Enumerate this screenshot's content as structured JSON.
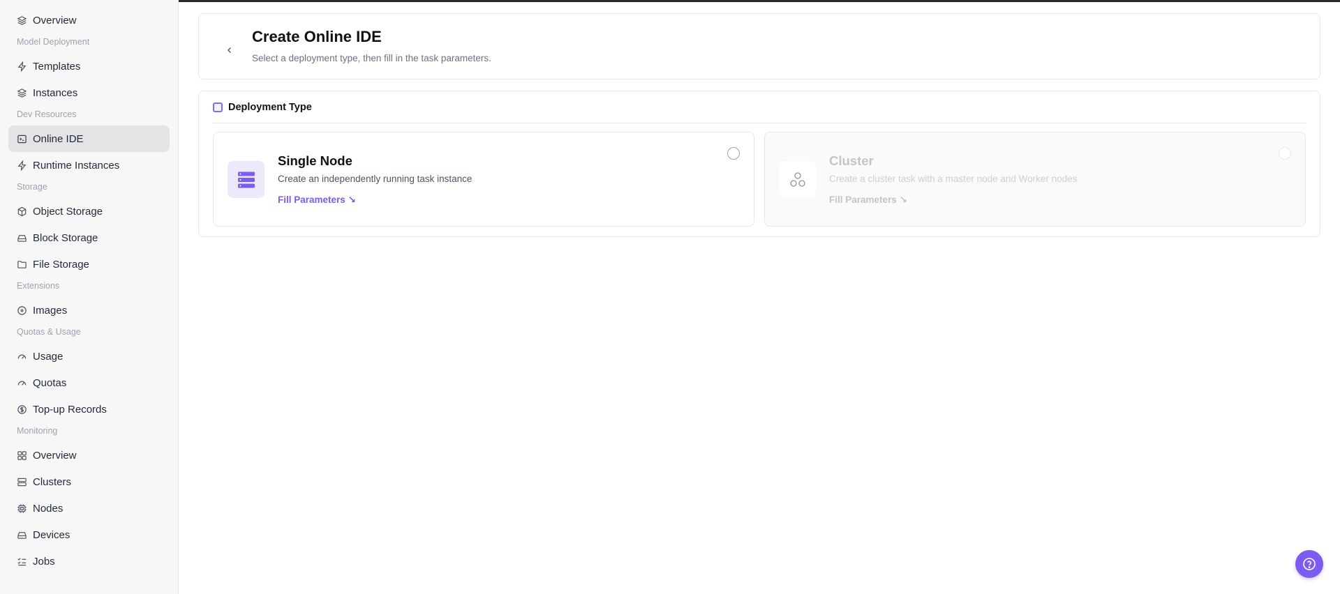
{
  "colors": {
    "accent": "#7c5cf0",
    "active_bg": "#e4e4e7",
    "muted": "#9ca3af"
  },
  "sidebar": {
    "items": [
      {
        "label": "Overview",
        "icon": "layers-icon"
      },
      {
        "section": "Model Deployment"
      },
      {
        "label": "Templates",
        "icon": "bolt-icon"
      },
      {
        "label": "Instances",
        "icon": "layers-icon"
      },
      {
        "section": "Dev Resources"
      },
      {
        "label": "Online IDE",
        "icon": "terminal-icon",
        "active": true
      },
      {
        "label": "Runtime Instances",
        "icon": "bolt-icon"
      },
      {
        "section": "Storage"
      },
      {
        "label": "Object Storage",
        "icon": "cube-icon"
      },
      {
        "label": "Block Storage",
        "icon": "drive-icon"
      },
      {
        "label": "File Storage",
        "icon": "folder-icon"
      },
      {
        "section": "Extensions"
      },
      {
        "label": "Images",
        "icon": "disc-icon"
      },
      {
        "section": "Quotas & Usage"
      },
      {
        "label": "Usage",
        "icon": "gauge-icon"
      },
      {
        "label": "Quotas",
        "icon": "gauge-icon"
      },
      {
        "label": "Top-up Records",
        "icon": "dollar-icon"
      },
      {
        "section": "Monitoring"
      },
      {
        "label": "Overview",
        "icon": "grid-icon"
      },
      {
        "label": "Clusters",
        "icon": "server-icon"
      },
      {
        "label": "Nodes",
        "icon": "chip-icon"
      },
      {
        "label": "Devices",
        "icon": "drive-icon"
      },
      {
        "label": "Jobs",
        "icon": "list-check-icon"
      }
    ]
  },
  "header": {
    "title": "Create Online IDE",
    "subtitle": "Select a deployment type, then fill in the task parameters.",
    "back_icon": "chevron-left-icon"
  },
  "deployment": {
    "heading": "Deployment Type",
    "options": [
      {
        "title": "Single Node",
        "description": "Create an independently running task instance",
        "link": "Fill Parameters ↘",
        "icon": "server-stack-icon",
        "enabled": true,
        "selected": false
      },
      {
        "title": "Cluster",
        "description": "Create a cluster task with a master node and Worker nodes",
        "link": "Fill Parameters ↘",
        "icon": "cluster-icon",
        "enabled": false,
        "selected": false
      }
    ]
  },
  "help": {
    "icon": "help-circle-icon"
  }
}
